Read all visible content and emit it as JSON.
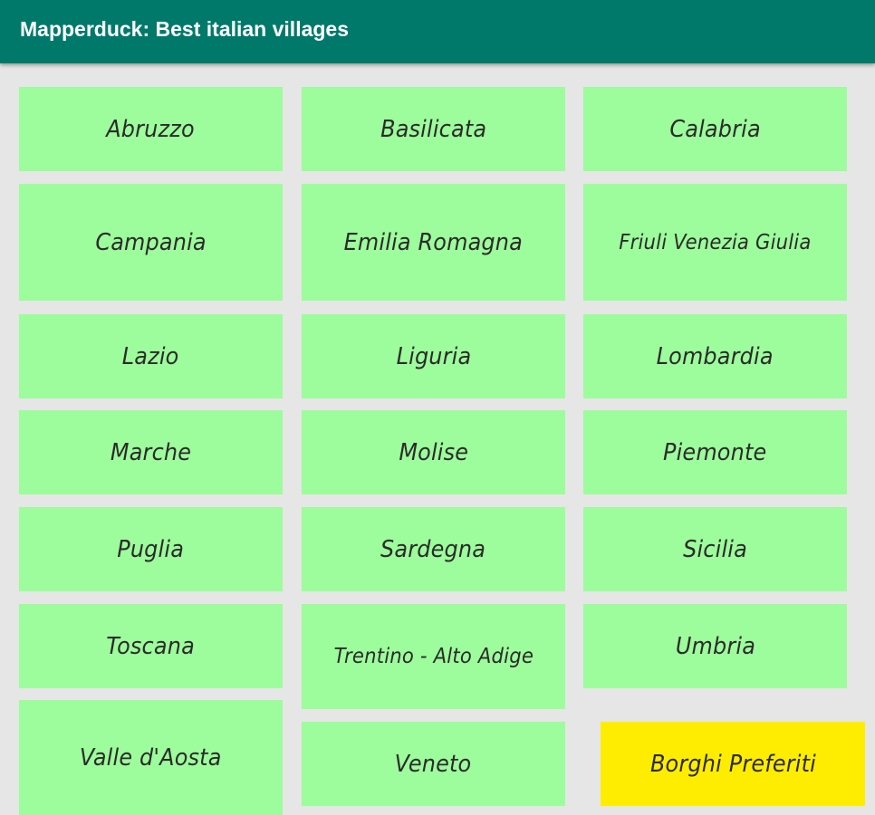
{
  "app_bar": {
    "title": "Mapperduck: Best italian villages"
  },
  "regions": [
    {
      "label": "Abruzzo"
    },
    {
      "label": "Basilicata"
    },
    {
      "label": "Calabria"
    },
    {
      "label": "Campania"
    },
    {
      "label": "Emilia Romagna"
    },
    {
      "label": "Friuli Venezia Giulia"
    },
    {
      "label": "Lazio"
    },
    {
      "label": "Liguria"
    },
    {
      "label": "Lombardia"
    },
    {
      "label": "Marche"
    },
    {
      "label": "Molise"
    },
    {
      "label": "Piemonte"
    },
    {
      "label": "Puglia"
    },
    {
      "label": "Sardegna"
    },
    {
      "label": "Sicilia"
    },
    {
      "label": "Toscana"
    },
    {
      "label": "Trentino - Alto Adige"
    },
    {
      "label": "Umbria"
    },
    {
      "label": "Valle d'Aosta"
    },
    {
      "label": "Veneto"
    }
  ],
  "favorites": {
    "label": "Borghi Preferiti"
  },
  "colors": {
    "app_bar": "#00796b",
    "tile": "#9dfc9b",
    "favorite_tile": "#ffed00",
    "background": "#e6e6e6"
  }
}
